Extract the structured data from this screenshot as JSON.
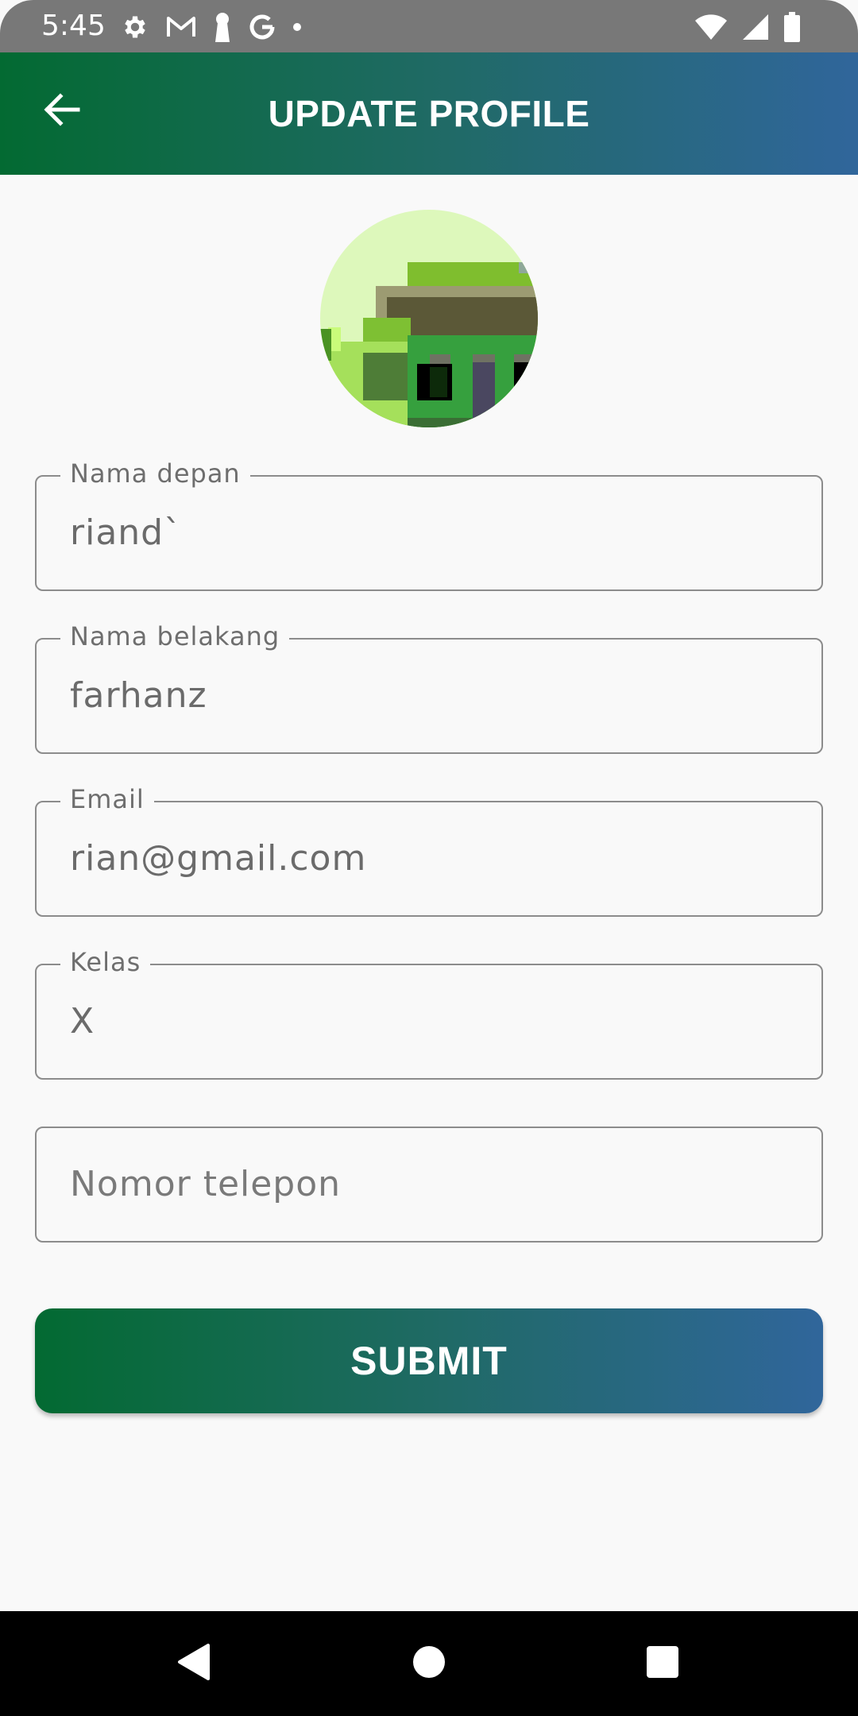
{
  "status_bar": {
    "time": "5:45",
    "left_icons": [
      "settings-icon",
      "gmail-icon",
      "keyhole-icon",
      "google-icon",
      "dot-icon"
    ],
    "right_icons": [
      "wifi-icon",
      "signal-icon",
      "battery-icon"
    ]
  },
  "app_bar": {
    "title": "UPDATE PROFILE",
    "back_icon": "arrow-back-icon",
    "gradient": [
      "#036a32",
      "#30669b"
    ]
  },
  "avatar": {
    "icon": "profile-photo"
  },
  "form": {
    "first_name": {
      "label": "Nama depan",
      "value": "riand`"
    },
    "last_name": {
      "label": "Nama belakang",
      "value": "farhanz"
    },
    "email": {
      "label": "Email",
      "value": "rian@gmail.com"
    },
    "class": {
      "label": "Kelas",
      "value": "X"
    },
    "phone": {
      "label": "",
      "value": "",
      "placeholder": "Nomor telepon"
    }
  },
  "submit_label": "SUBMIT",
  "nav_bar": {
    "buttons": [
      "back-triangle-icon",
      "home-circle-icon",
      "recents-square-icon"
    ]
  },
  "colors": {
    "background": "#f9f9f9",
    "status_bar": "#787878",
    "field_border": "#8c8c8c",
    "text": "#6b6b6b"
  }
}
